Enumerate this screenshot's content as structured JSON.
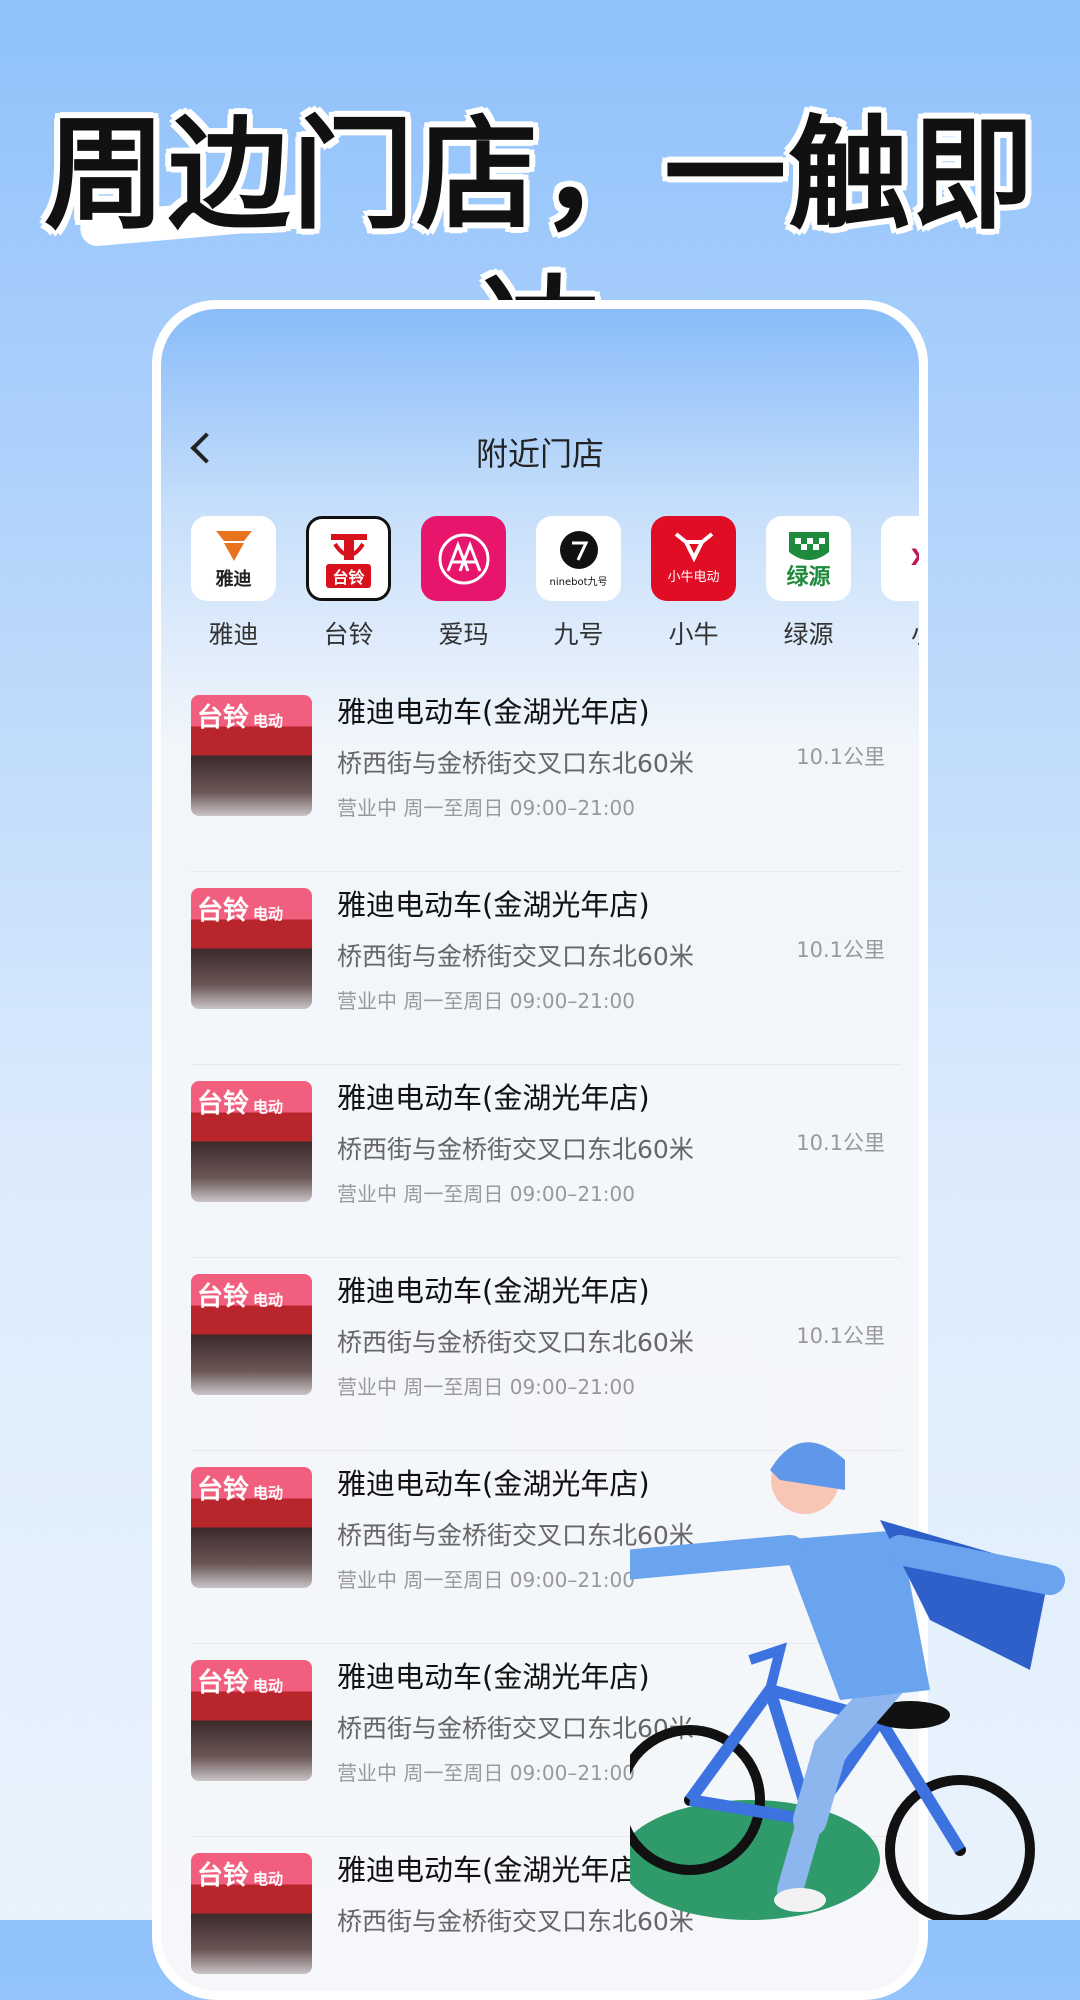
{
  "banner": {
    "title": "周边门店，一触即达"
  },
  "nav": {
    "title": "附近门店"
  },
  "brands": [
    {
      "name": "雅迪",
      "logo_text": "雅迪"
    },
    {
      "name": "台铃",
      "logo_text": "台铃"
    },
    {
      "name": "爱玛",
      "logo_text": ""
    },
    {
      "name": "九号",
      "logo_text": "ninebot九号"
    },
    {
      "name": "小牛",
      "logo_text": "小牛电动"
    },
    {
      "name": "绿源",
      "logo_text": "绿源"
    },
    {
      "name": "小",
      "logo_text": "XI"
    }
  ],
  "stores": [
    {
      "name": "雅迪电动车(金湖光年店)",
      "address": "桥西街与金桥街交叉口东北60米",
      "hours": "营业中 周一至周日 09:00–21:00",
      "distance": "10.1公里",
      "sign": "台铃",
      "sign_sub": "电动"
    },
    {
      "name": "雅迪电动车(金湖光年店)",
      "address": "桥西街与金桥街交叉口东北60米",
      "hours": "营业中 周一至周日 09:00–21:00",
      "distance": "10.1公里",
      "sign": "台铃",
      "sign_sub": "电动"
    },
    {
      "name": "雅迪电动车(金湖光年店)",
      "address": "桥西街与金桥街交叉口东北60米",
      "hours": "营业中 周一至周日 09:00–21:00",
      "distance": "10.1公里",
      "sign": "台铃",
      "sign_sub": "电动"
    },
    {
      "name": "雅迪电动车(金湖光年店)",
      "address": "桥西街与金桥街交叉口东北60米",
      "hours": "营业中 周一至周日 09:00–21:00",
      "distance": "10.1公里",
      "sign": "台铃",
      "sign_sub": "电动"
    },
    {
      "name": "雅迪电动车(金湖光年店)",
      "address": "桥西街与金桥街交叉口东北60米",
      "hours": "营业中 周一至周日 09:00–21:00",
      "distance": "",
      "sign": "台铃",
      "sign_sub": "电动"
    },
    {
      "name": "雅迪电动车(金湖光年店)",
      "address": "桥西街与金桥街交叉口东北60米",
      "hours": "营业中 周一至周日 09:00–21:00",
      "distance": "",
      "sign": "台铃",
      "sign_sub": "电动"
    },
    {
      "name": "雅迪电动车(金湖光年店)",
      "address": "桥西街与金桥街交叉口东北60米",
      "hours": "",
      "distance": "",
      "sign": "台铃",
      "sign_sub": "电动"
    }
  ],
  "colors": {
    "yadea": "#e8731c",
    "tailg": "#d7121d",
    "aima": "#e8156c",
    "niu": "#e10d25",
    "luyuan": "#1e8a3b"
  },
  "icons": {
    "back": "chevron-left-icon"
  }
}
